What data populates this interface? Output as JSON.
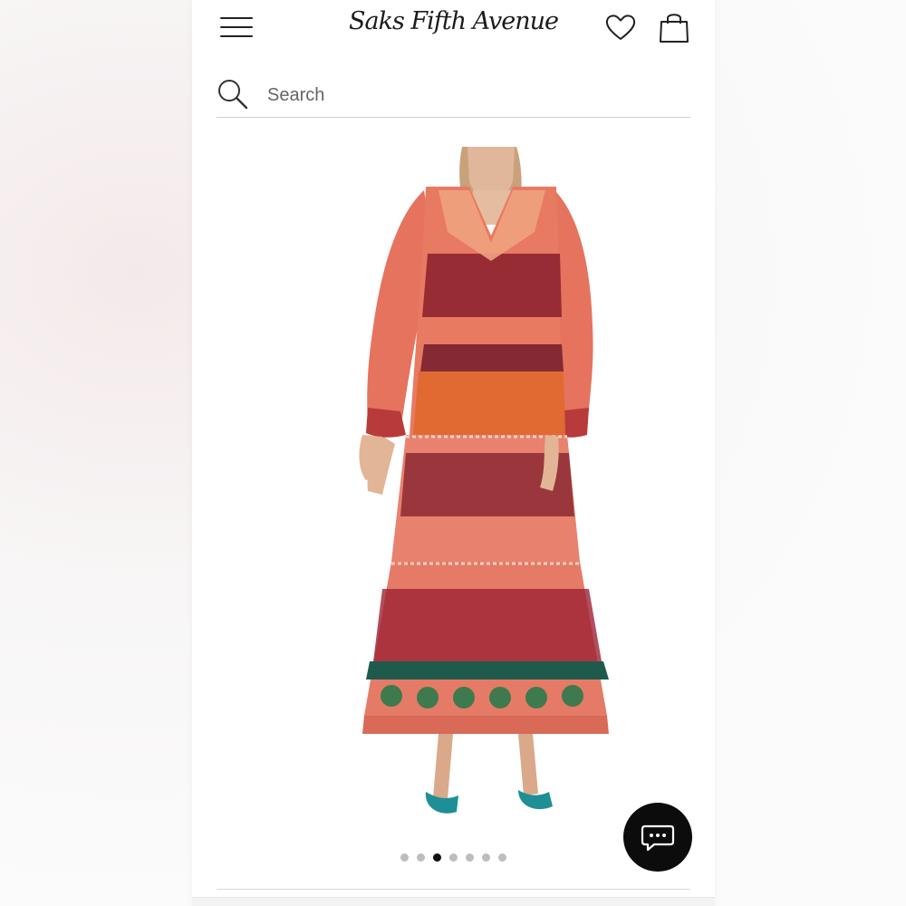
{
  "header": {
    "logo_text": "Saks Fifth Avenue",
    "menu_icon": "hamburger-menu-icon",
    "wishlist_icon": "heart-icon",
    "bag_icon": "shopping-bag-icon"
  },
  "search": {
    "placeholder": "Search",
    "value": "",
    "icon": "search-icon"
  },
  "product": {
    "image_count": 7,
    "active_image_index": 2
  },
  "chat": {
    "icon": "chat-bubble-icon"
  },
  "colors": {
    "dress_coral": "#e8816e",
    "dress_burgundy": "#8a1f2e",
    "dress_orange": "#e06a32",
    "dress_green": "#3e7a4e",
    "sandal_teal": "#1d8f95",
    "chat_bg": "#0c0c0c",
    "active_dot": "#111111",
    "inactive_dot": "#bdbdbd"
  }
}
